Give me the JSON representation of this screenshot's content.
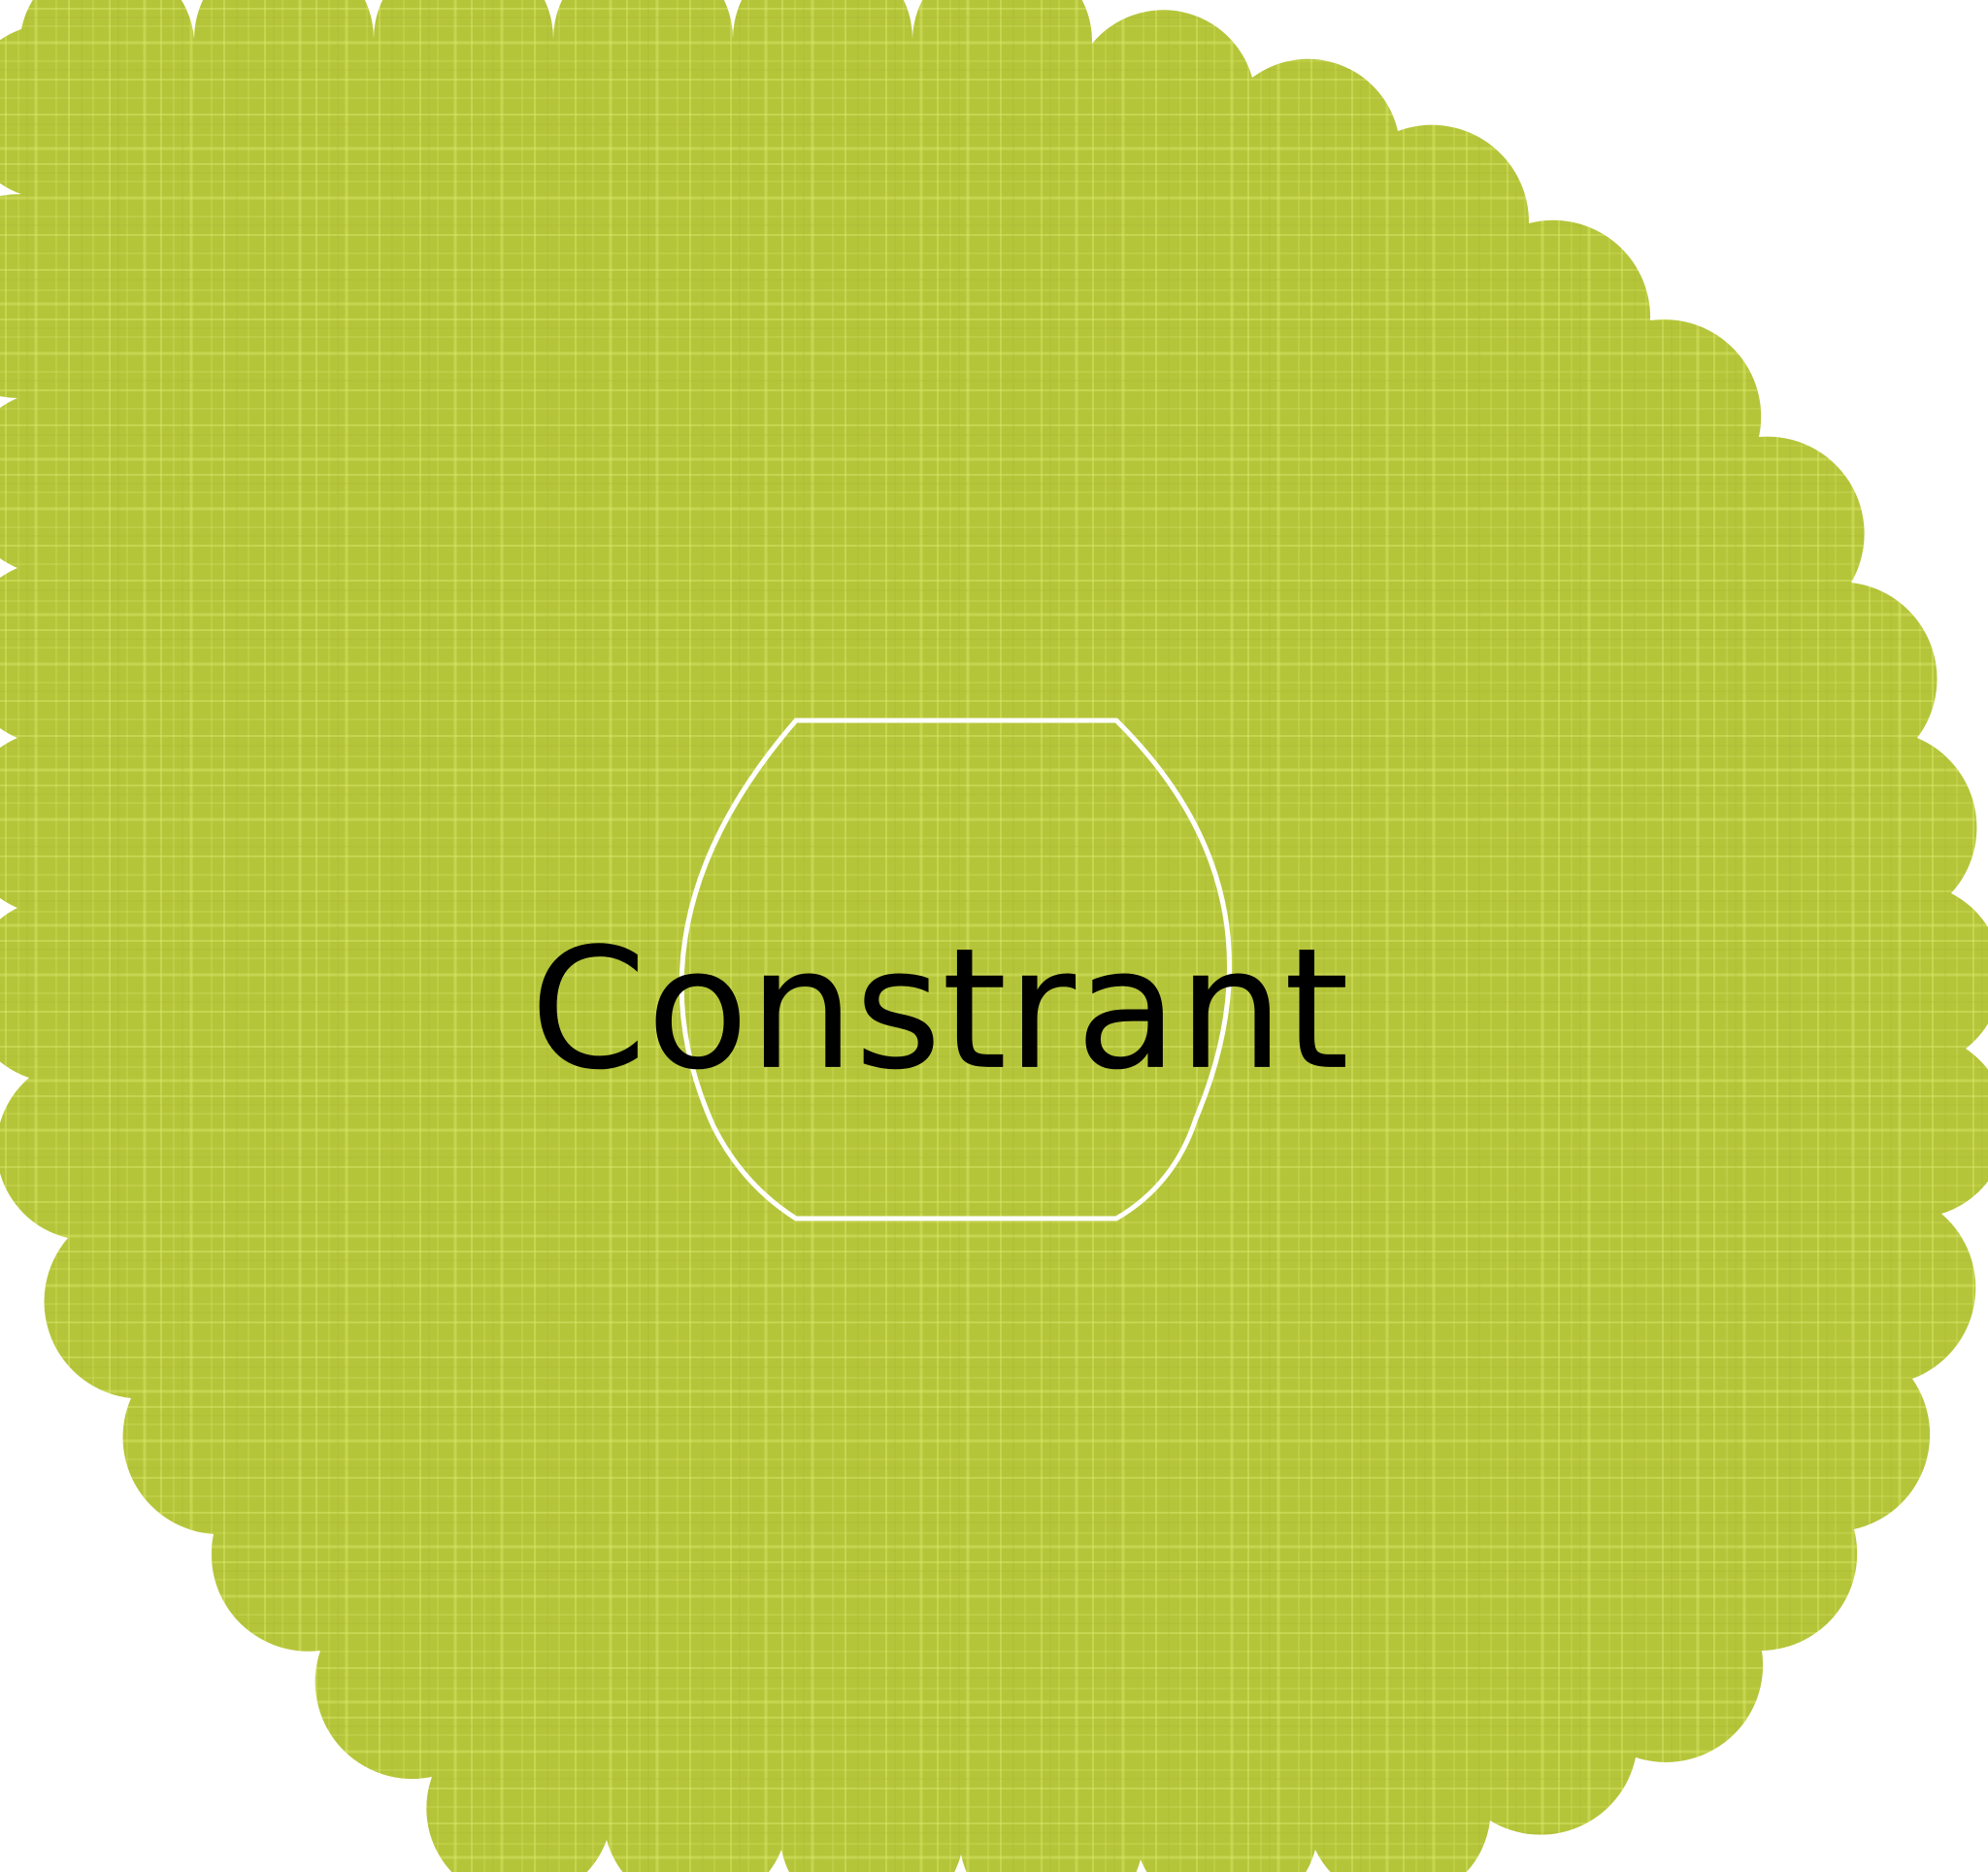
{
  "diagram": {
    "label": "Constrant",
    "colors": {
      "leaf_fill": "#b5c53a",
      "leaf_fill_dark": "#a9b830",
      "weave_light": "#dde96a",
      "frame_stroke": "#ffffff",
      "label_color": "#000000",
      "background": "#ffffff"
    }
  }
}
